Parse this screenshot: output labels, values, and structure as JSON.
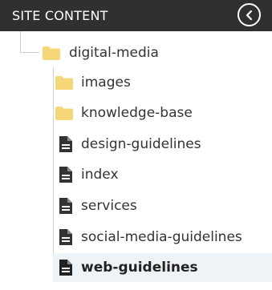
{
  "header": {
    "title": "SITE CONTENT"
  },
  "tree": {
    "root": {
      "label": "digital-media",
      "icon": "folder-icon"
    },
    "children": [
      {
        "label": "images",
        "icon": "folder-icon",
        "selected": false
      },
      {
        "label": "knowledge-base",
        "icon": "folder-icon",
        "selected": false
      },
      {
        "label": "design-guidelines",
        "icon": "document-icon",
        "selected": false
      },
      {
        "label": "index",
        "icon": "document-icon",
        "selected": false
      },
      {
        "label": "services",
        "icon": "document-icon",
        "selected": false
      },
      {
        "label": "social-media-guidelines",
        "icon": "document-icon",
        "selected": false
      },
      {
        "label": "web-guidelines",
        "icon": "document-icon",
        "selected": true
      }
    ]
  },
  "colors": {
    "header_bg": "#303030",
    "folder": "#f5d77a",
    "document": "#333333",
    "selected_bg": "#eef3f8"
  }
}
